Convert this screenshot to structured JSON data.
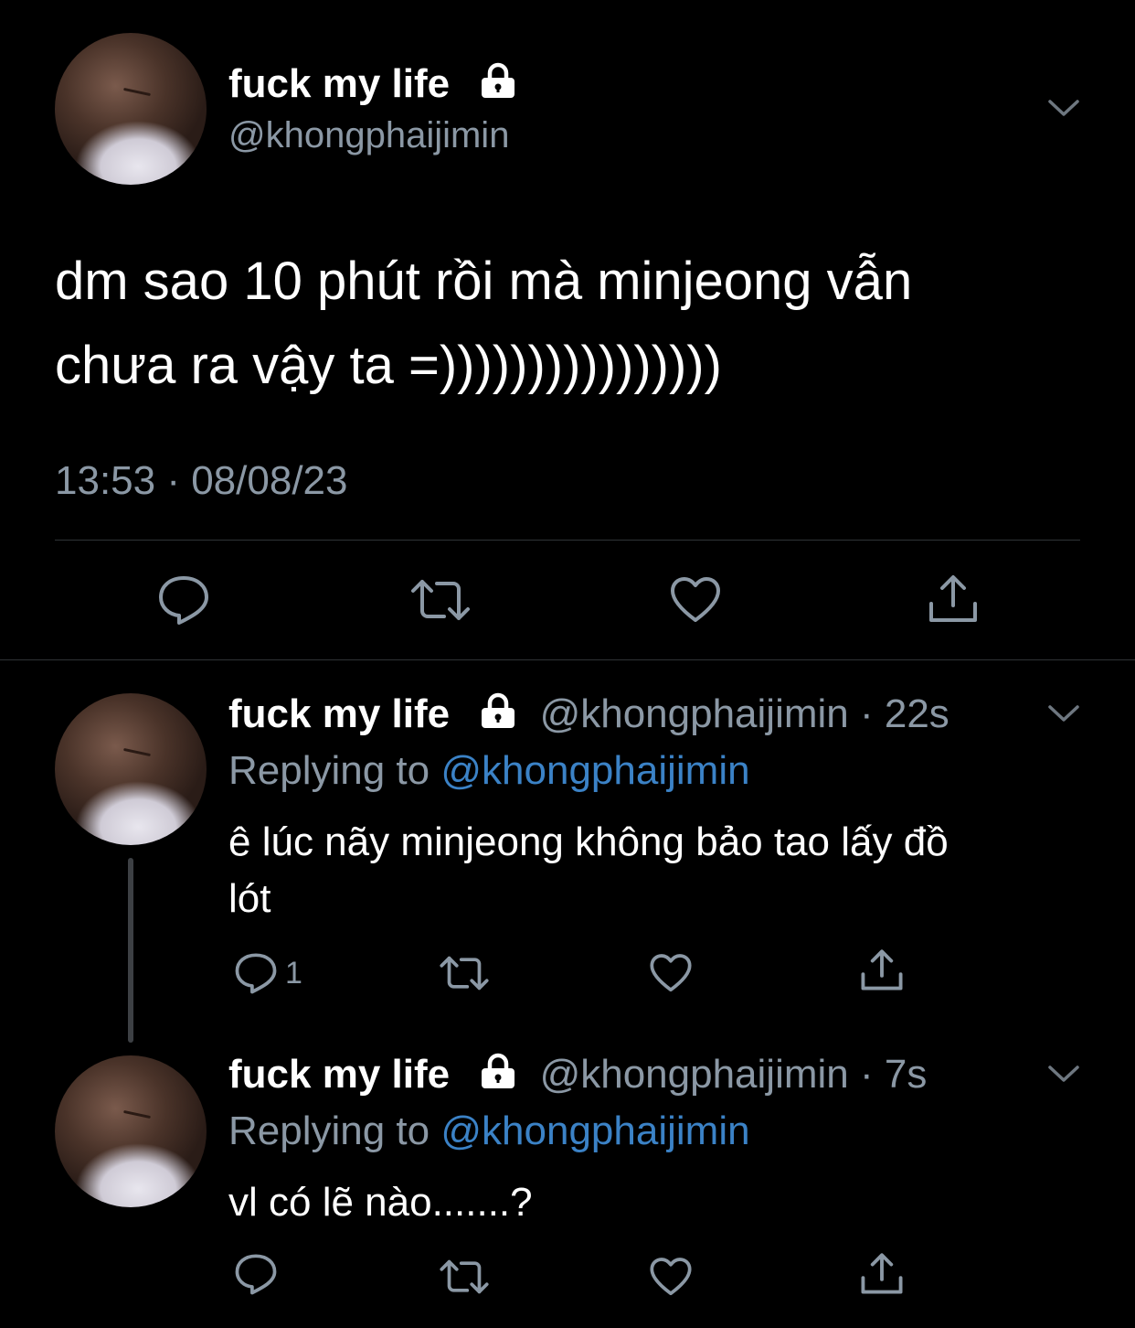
{
  "main_tweet": {
    "display_name": "fuck my life",
    "handle": "@khongphaijimin",
    "text_line1": "dm sao 10 phút rồi mà minjeong vẫn",
    "text_line2": "chưa ra vậy ta =))))))))))))))))",
    "timestamp": "13:53 · 08/08/23"
  },
  "replies": [
    {
      "display_name": "fuck my life",
      "handle": "@khongphaijimin",
      "time": "· 22s",
      "replying_prefix": "Replying to",
      "replying_handle": "@khongphaijimin",
      "text_line1": "ê lúc nãy minjeong không bảo tao lấy đồ",
      "text_line2": "lót",
      "reply_count": "1"
    },
    {
      "display_name": "fuck my life",
      "handle": "@khongphaijimin",
      "time": "· 7s",
      "replying_prefix": "Replying to",
      "replying_handle": "@khongphaijimin",
      "text_line1": "vl có lẽ nào.......?",
      "reply_count": ""
    }
  ],
  "colors": {
    "background": "#000000",
    "text": "#ffffff",
    "secondary": "#8b98a5",
    "link": "#3b82c6",
    "divider": "#2f3336"
  },
  "icons": [
    "lock-icon",
    "chevron-down-icon",
    "reply-icon",
    "retweet-icon",
    "like-icon",
    "share-icon"
  ]
}
